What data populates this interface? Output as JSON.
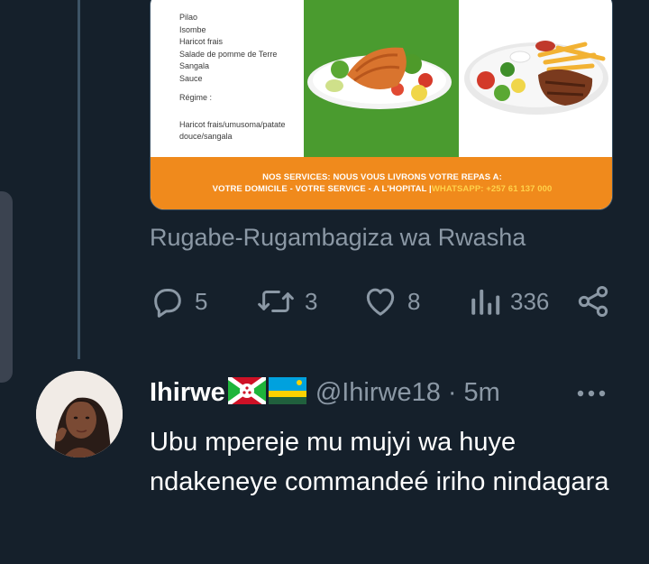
{
  "media": {
    "menu_items": [
      "Pilao",
      "Isombe",
      "Haricot frais",
      "Salade de pomme de Terre",
      "Sangala",
      "Sauce"
    ],
    "regime_label": "Régime :",
    "regime_items": [
      "Haricot frais/umusoma/patate",
      "douce/sangala"
    ],
    "banner_line1": "NOS SERVICES: NOUS VOUS LIVRONS VOTRE REPAS A:",
    "banner_line2": "VOTRE DOMICILE - VOTRE SERVICE - A L'HOPITAL |",
    "banner_whatsapp": "WHATSAPP: +257 61 137 000",
    "colors": {
      "green": "#4a9b2f",
      "orange": "#f08a1c",
      "whatsapp": "#ffd24a"
    }
  },
  "attribution": "Rugabe-Rugambagiza wa Rwasha",
  "actions": {
    "reply_count": "5",
    "retweet_count": "3",
    "like_count": "8",
    "views_count": "336"
  },
  "tweet": {
    "name": "Ihirwe",
    "handle": "@Ihirwe18",
    "separator": "·",
    "time": "5m",
    "text": "Ubu mpereje mu mujyi wa huye ndakeneye commandeé iriho nindagara"
  },
  "icons": {
    "reply": "reply-icon",
    "retweet": "retweet-icon",
    "like": "heart-icon",
    "views": "views-icon",
    "share": "share-icon",
    "more": "more-icon"
  },
  "theme": {
    "background": "#15202b",
    "muted": "#8b98a5",
    "text": "#ffffff"
  }
}
